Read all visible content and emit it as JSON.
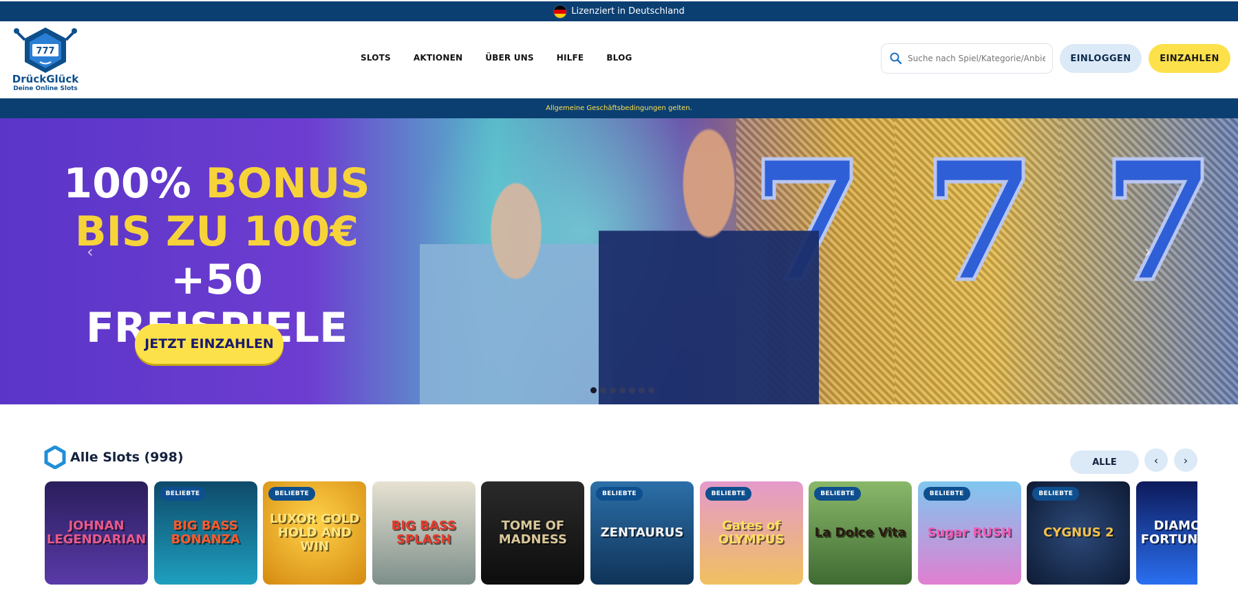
{
  "topbar": {
    "license_text": "Lizenziert in Deutschland"
  },
  "header": {
    "logo": {
      "name": "DrückGlück",
      "tagline": "Deine Online Slots",
      "reel_text": "777"
    },
    "nav": [
      "SLOTS",
      "AKTIONEN",
      "ÜBER UNS",
      "HILFE",
      "BLOG"
    ],
    "search_placeholder": "Suche nach Spiel/Kategorie/Anbiet",
    "login_label": "EINLOGGEN",
    "deposit_label": "EINZAHLEN"
  },
  "terms_text": "Allgemeine Geschäftsbedingungen gelten.",
  "hero": {
    "line1_white": "100%",
    "line1_yellow": "BONUS",
    "line2": "BIS ZU 100€",
    "line3": "+50 FREISPIELE",
    "cta": "JETZT EINZAHLEN",
    "prev_arrow": "‹",
    "next_arrow": "›",
    "slide_count": 7,
    "active_slide": 1,
    "seven": "7"
  },
  "slots_section": {
    "title": "Alle Slots (998)",
    "filter_label": "ALLE",
    "prev": "‹",
    "next": "›",
    "games": [
      {
        "title": "JOHNAN LEGENDARIAN",
        "badge": ""
      },
      {
        "title": "BIG BASS BONANZA",
        "badge": "BELIEBTE"
      },
      {
        "title": "LUXOR GOLD HOLD AND WIN",
        "badge": "BELIEBTE"
      },
      {
        "title": "BIG BASS SPLASH",
        "badge": ""
      },
      {
        "title": "TOME OF MADNESS",
        "badge": ""
      },
      {
        "title": "ZENTAURUS",
        "badge": "BELIEBTE"
      },
      {
        "title": "Gates of OLYMPUS",
        "badge": "BELIEBTE"
      },
      {
        "title": "La Dolce Vita",
        "badge": "BELIEBTE"
      },
      {
        "title": "Sugar RUSH",
        "badge": "BELIEBTE"
      },
      {
        "title": "CYGNUS 2",
        "badge": "BELIEBTE"
      },
      {
        "title": "DIAMOND FORTUNATOR",
        "badge": ""
      }
    ]
  },
  "colors": {
    "navy": "#0b3f72",
    "yellow": "#fde14a",
    "light_blue": "#dce9f7"
  }
}
